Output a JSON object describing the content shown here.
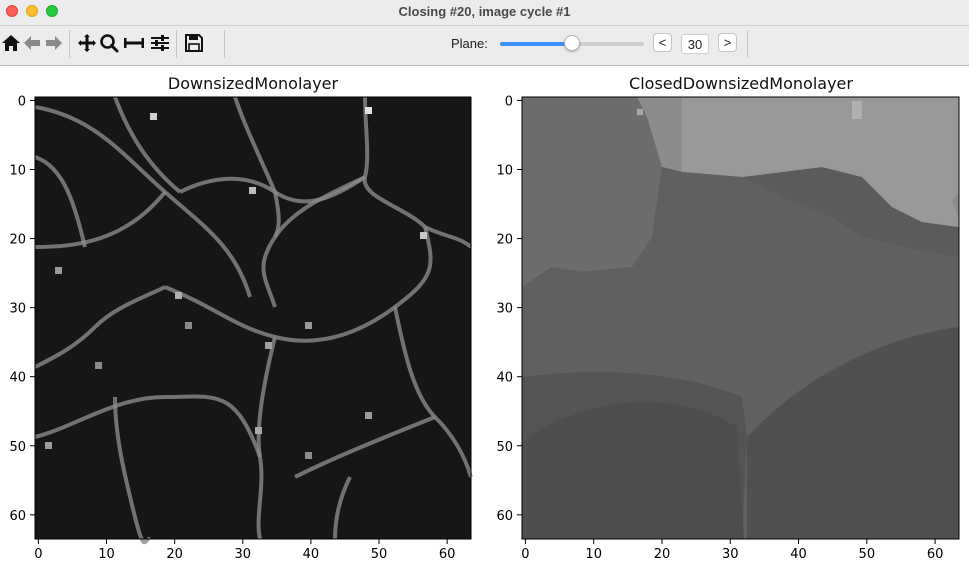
{
  "window": {
    "title": "Closing #20, image cycle #1"
  },
  "toolbar": {
    "buttons": [
      {
        "name": "home",
        "icon": "home-icon"
      },
      {
        "name": "back",
        "icon": "arrow-left-icon"
      },
      {
        "name": "forward",
        "icon": "arrow-right-icon"
      },
      {
        "name": "pan",
        "icon": "move-icon"
      },
      {
        "name": "zoom",
        "icon": "zoom-icon"
      },
      {
        "name": "subplots",
        "icon": "subplots-icon"
      },
      {
        "name": "customize",
        "icon": "sliders-icon"
      },
      {
        "name": "save",
        "icon": "save-icon"
      }
    ],
    "plane": {
      "label": "Plane:",
      "value": "30",
      "slider_fraction": 0.5,
      "prev_label": "<",
      "next_label": ">",
      "accent": "#3d8ef7"
    }
  },
  "panels": [
    {
      "title": "DownsizedMonolayer"
    },
    {
      "title": "ClosedDownsizedMonolayer"
    }
  ],
  "chart_data": [
    {
      "type": "heatmap",
      "title": "DownsizedMonolayer",
      "x_ticks": [
        "0",
        "10",
        "20",
        "30",
        "40",
        "50",
        "60"
      ],
      "y_ticks": [
        "0",
        "10",
        "20",
        "30",
        "40",
        "50",
        "60"
      ],
      "xlim": [
        -0.5,
        63.5
      ],
      "ylim": [
        63.5,
        -0.5
      ],
      "colormap": "gray",
      "grid": false,
      "description_free": true
    },
    {
      "type": "heatmap",
      "title": "ClosedDownsizedMonolayer",
      "x_ticks": [
        "0",
        "10",
        "20",
        "30",
        "40",
        "50",
        "60"
      ],
      "y_ticks": [
        "0",
        "10",
        "20",
        "30",
        "40",
        "50",
        "60"
      ],
      "xlim": [
        -0.5,
        63.5
      ],
      "ylim": [
        63.5,
        -0.5
      ],
      "colormap": "gray",
      "grid": false
    }
  ]
}
